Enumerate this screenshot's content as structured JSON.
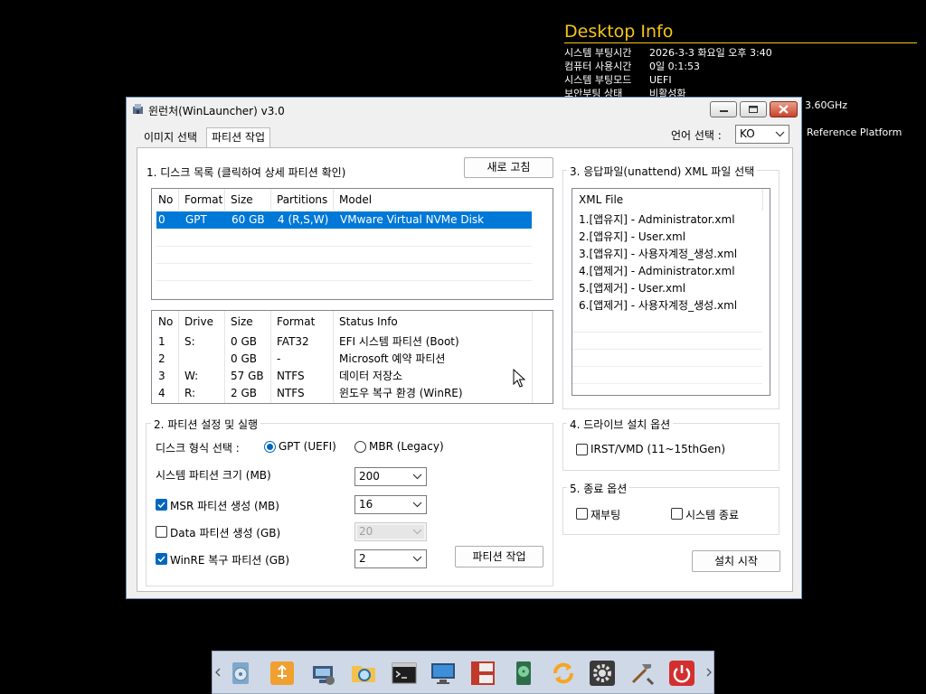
{
  "desktop_info": {
    "title": "Desktop Info",
    "rows": [
      {
        "key": "시스템 부팅시간",
        "value": "2026-3-3 화요일 오후 3:40"
      },
      {
        "key": "컴퓨터 사용시간",
        "value": "0일 0:1:53"
      },
      {
        "key": "시스템 부팅모드",
        "value": "UEFI"
      },
      {
        "key": "보안부팅 상태",
        "value": "비활성화"
      }
    ],
    "cpu_suffix": "3.60GHz",
    "platform": "Reference Platform"
  },
  "window": {
    "title": "윈런처(WinLauncher) v3.0",
    "tabs": [
      "이미지 선택",
      "파티션 작업"
    ],
    "language_label": "언어 선택 :",
    "language_value": "KO"
  },
  "disk_section": {
    "title": "1. 디스크 목록 (클릭하여 상세 파티션 확인)",
    "refresh_label": "새로 고침",
    "columns": [
      "No",
      "Format",
      "Size",
      "Partitions",
      "Model"
    ],
    "rows": [
      {
        "no": "0",
        "format": "GPT",
        "size": "60 GB",
        "partitions": "4 (R,S,W)",
        "model": "VMware Virtual NVMe Disk"
      }
    ]
  },
  "partition_list": {
    "columns": [
      "No",
      "Drive",
      "Size",
      "Format",
      "Status Info"
    ],
    "rows": [
      {
        "no": "1",
        "drive": "S:",
        "size": "0 GB",
        "format": "FAT32",
        "status": "EFI 시스템 파티션 (Boot)"
      },
      {
        "no": "2",
        "drive": "",
        "size": "0 GB",
        "format": "-",
        "status": "Microsoft 예약 파티션"
      },
      {
        "no": "3",
        "drive": "W:",
        "size": "57 GB",
        "format": "NTFS",
        "status": "데이터 저장소"
      },
      {
        "no": "4",
        "drive": "R:",
        "size": "2 GB",
        "format": "NTFS",
        "status": "윈도우 복구 환경 (WinRE)"
      }
    ]
  },
  "xml_section": {
    "title": "3. 응답파일(unattend) XML 파일 선택",
    "column": "XML File",
    "items": [
      "1.[앱유지] - Administrator.xml",
      "2.[앱유지] - User.xml",
      "3.[앱유지] - 사용자계정_생성.xml",
      "4.[앱제거] - Administrator.xml",
      "5.[앱제거] - User.xml",
      "6.[앱제거] - 사용자계정_생성.xml"
    ]
  },
  "partition_settings": {
    "title": "2. 파티션 설정 및 실행",
    "disk_type_label": "디스크 형식 선택 :",
    "gpt_label": "GPT (UEFI)",
    "mbr_label": "MBR (Legacy)",
    "gpt_selected": true,
    "system_size_label": "시스템 파티션 크기 (MB)",
    "system_size_value": "200",
    "msr_label": "MSR 파티션 생성 (MB)",
    "msr_checked": true,
    "msr_value": "16",
    "data_label": "Data 파티션 생성 (GB)",
    "data_checked": false,
    "data_value": "20",
    "winre_label": "WinRE 복구 파티션 (GB)",
    "winre_checked": true,
    "winre_value": "2",
    "run_label": "파티션 작업"
  },
  "drive_options": {
    "title": "4. 드라이브 설치 옵션",
    "irst_label": "IRST/VMD (11~15thGen)",
    "irst_checked": false
  },
  "exit_options": {
    "title": "5. 종료 옵션",
    "reboot_label": "재부팅",
    "reboot_checked": false,
    "shutdown_label": "시스템 종료",
    "shutdown_checked": false
  },
  "start_label": "설치 시작",
  "taskbar_icons": [
    "setup-disc-icon",
    "usb-drive-icon",
    "network-settings-icon",
    "folder-search-icon",
    "command-prompt-icon",
    "monitor-icon",
    "partition-tool-icon",
    "disk-check-icon",
    "sync-icon",
    "settings-gear-icon",
    "tools-icon",
    "power-icon"
  ],
  "colors": {
    "accent": "#0078d7",
    "check": "#0067c0",
    "desktop_title": "#f5c518"
  }
}
